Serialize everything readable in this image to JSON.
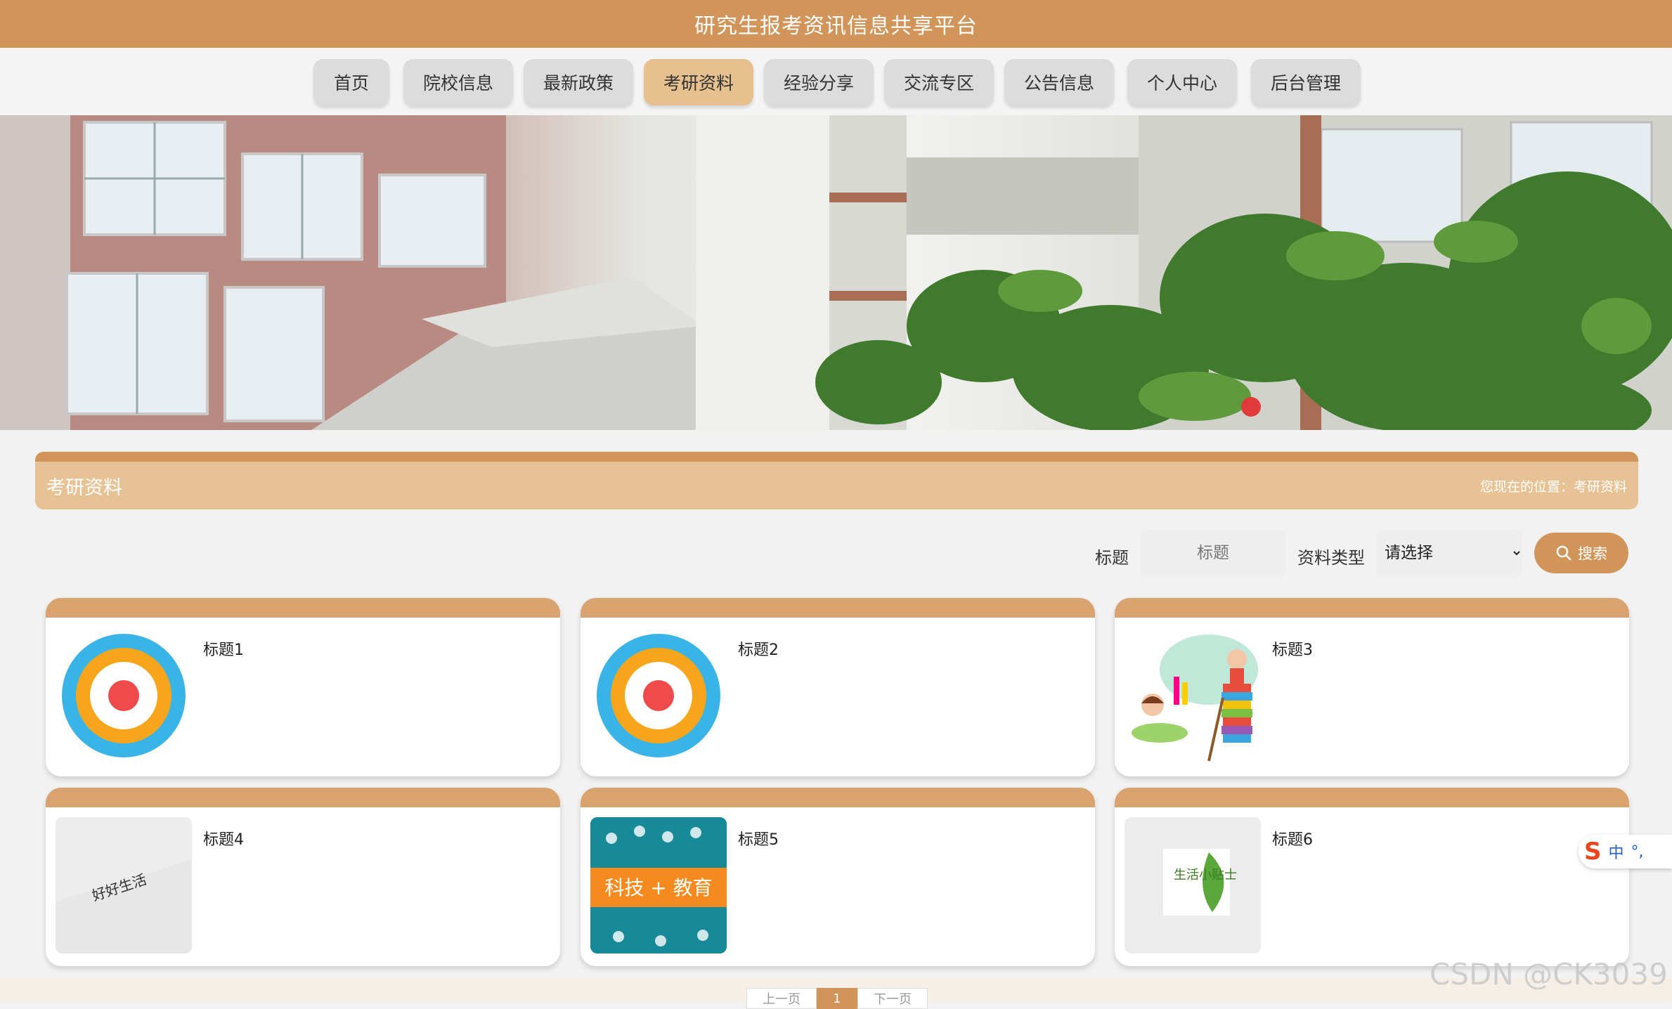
{
  "header": {
    "title": "研究生报考资讯信息共享平台"
  },
  "nav": {
    "items": [
      {
        "label": "首页"
      },
      {
        "label": "院校信息"
      },
      {
        "label": "最新政策"
      },
      {
        "label": "考研资料"
      },
      {
        "label": "经验分享"
      },
      {
        "label": "交流专区"
      },
      {
        "label": "公告信息"
      },
      {
        "label": "个人中心"
      },
      {
        "label": "后台管理"
      }
    ],
    "active": "考研资料"
  },
  "section": {
    "title": "考研资料",
    "breadcrumb": "您现在的位置：考研资料"
  },
  "search": {
    "title_label": "标题",
    "title_placeholder": "标题",
    "type_label": "资料类型",
    "type_selected": "请选择",
    "button_label": "搜索"
  },
  "cards": [
    {
      "title": "标题1",
      "thumb": "target-circle-image"
    },
    {
      "title": "标题2",
      "thumb": "target-circle-image"
    },
    {
      "title": "标题3",
      "thumb": "kids-books-image"
    },
    {
      "title": "标题4",
      "thumb": "paper-note-image",
      "thumb_text": "好好生活"
    },
    {
      "title": "标题5",
      "thumb": "tech-education-image",
      "thumb_text": "科技 + 教育"
    },
    {
      "title": "标题6",
      "thumb": "leaf-tip-image",
      "thumb_text": "生活小贴士"
    }
  ],
  "pagination": {
    "prev": "上一页",
    "current": "1",
    "next": "下一页"
  },
  "ime": {
    "lang": "中",
    "punct": "°,"
  },
  "watermark": "CSDN @CK3039"
}
